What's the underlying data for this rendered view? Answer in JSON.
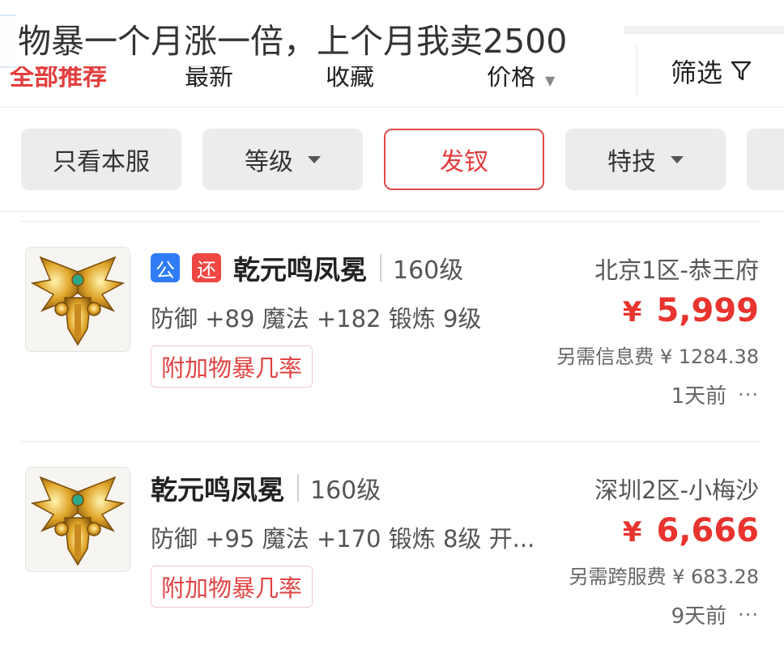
{
  "overlay_caption": "物暴一个月涨一倍，上个月我卖2500",
  "sort_tabs": [
    {
      "label": "全部推荐"
    },
    {
      "label": "最新"
    },
    {
      "label": "收藏"
    },
    {
      "label": "价格"
    }
  ],
  "filter_button": {
    "label": "筛选",
    "icon": "funnel-icon"
  },
  "chips": [
    {
      "label": "只看本服"
    },
    {
      "label": "等级"
    },
    {
      "label": "发钗"
    },
    {
      "label": "特技"
    }
  ],
  "listings": [
    {
      "badges": [
        "公",
        "还"
      ],
      "name": "乾元鸣凤冕",
      "level": "160级",
      "stats": "防御 +89 魔法 +182 锻炼 9级",
      "tag": "附加物暴几率",
      "server": "北京1区-恭王府",
      "currency": "¥",
      "price": "5,999",
      "fee": "另需信息费 ¥ 1284.38",
      "time": "1天前",
      "more": "···"
    },
    {
      "badges": [],
      "name": "乾元鸣凤冕",
      "level": "160级",
      "stats": "防御 +95 魔法 +170 锻炼 8级 开...",
      "tag": "附加物暴几率",
      "server": "深圳2区-小梅沙",
      "currency": "¥",
      "price": "6,666",
      "fee": "另需跨服费 ¥ 683.28",
      "time": "9天前",
      "more": "···"
    }
  ],
  "colors": {
    "accent_red": "#e8332e",
    "badge_blue": "#2f7cf6",
    "badge_red": "#ef4743"
  }
}
